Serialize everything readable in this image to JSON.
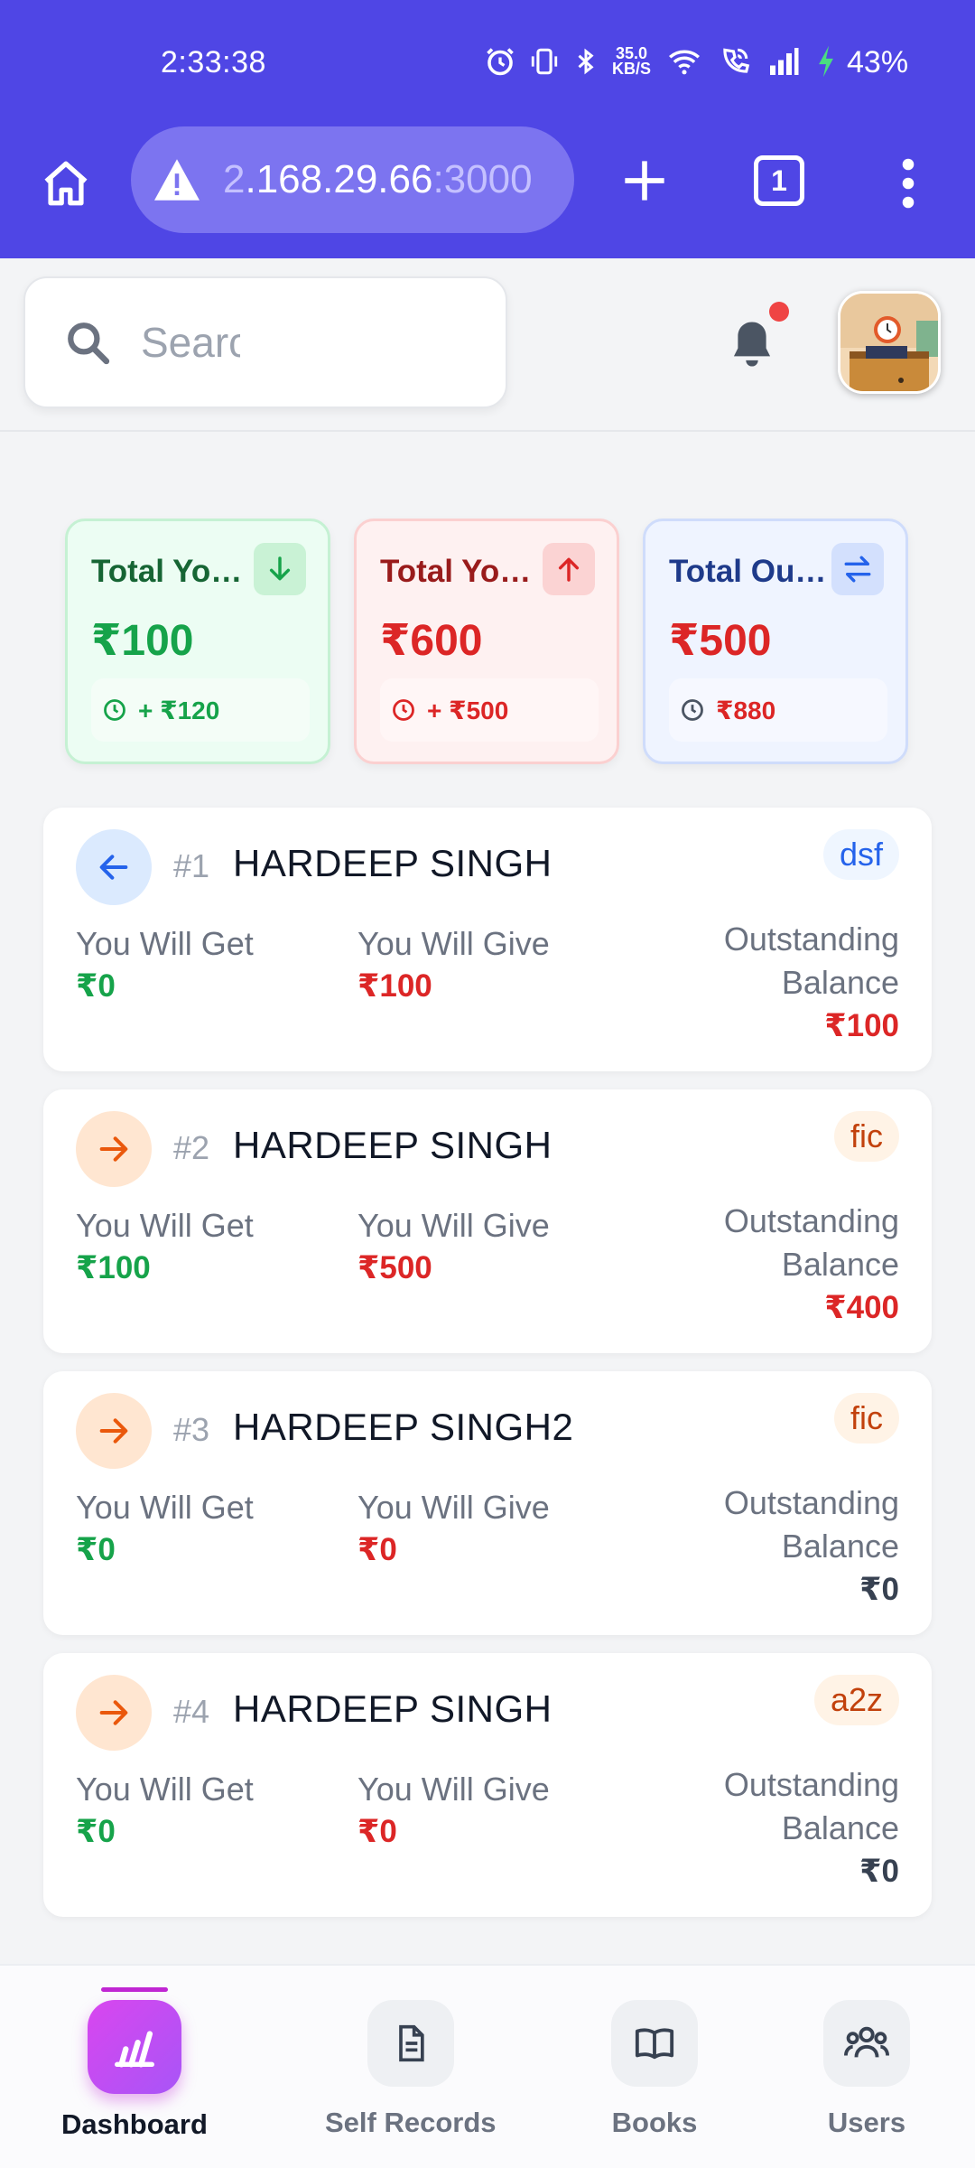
{
  "status_bar": {
    "time": "2:33:38",
    "net_speed_value": "35.0",
    "net_speed_unit": "KB/S",
    "battery": "43%"
  },
  "browser": {
    "url_dim_prefix": "2",
    "url_main": ".168.29.66",
    "url_dim_suffix": ":3000",
    "tab_count": "1"
  },
  "header": {
    "search_placeholder": "Search",
    "notification_dot": true
  },
  "summary": [
    {
      "title": "Total You Will Get",
      "amount": "₹100",
      "sub": "+ ₹120",
      "icon": "arrow-down-icon",
      "tone": "green"
    },
    {
      "title": "Total You Will Give",
      "amount": "₹600",
      "sub": "+ ₹500",
      "icon": "arrow-up-icon",
      "tone": "red"
    },
    {
      "title": "Total Outstanding",
      "amount": "₹500",
      "sub": "₹880",
      "icon": "swap-icon",
      "tone": "blue"
    }
  ],
  "labels": {
    "get": "You Will Get",
    "give": "You Will Give",
    "balance_line1": "Outstanding",
    "balance_line2": "Balance"
  },
  "records": [
    {
      "index": "#1",
      "name": "HARDEEP SINGH",
      "tag": "dsf",
      "direction": "in",
      "get": "₹0",
      "give": "₹100",
      "balance": "₹100"
    },
    {
      "index": "#2",
      "name": "HARDEEP SINGH",
      "tag": "fic",
      "direction": "out",
      "get": "₹100",
      "give": "₹500",
      "balance": "₹400"
    },
    {
      "index": "#3",
      "name": "HARDEEP SINGH2",
      "tag": "fic",
      "direction": "out",
      "get": "₹0",
      "give": "₹0",
      "balance": "₹0"
    },
    {
      "index": "#4",
      "name": "HARDEEP SINGH",
      "tag": "a2z",
      "direction": "out",
      "get": "₹0",
      "give": "₹0",
      "balance": "₹0"
    }
  ],
  "nav": {
    "dashboard": "Dashboard",
    "self_records": "Self Records",
    "books": "Books",
    "users": "Users"
  },
  "colors": {
    "brand": "#4f46e5",
    "positive": "#16a34a",
    "negative": "#dc2626",
    "accent_nav": "#c026d3"
  }
}
